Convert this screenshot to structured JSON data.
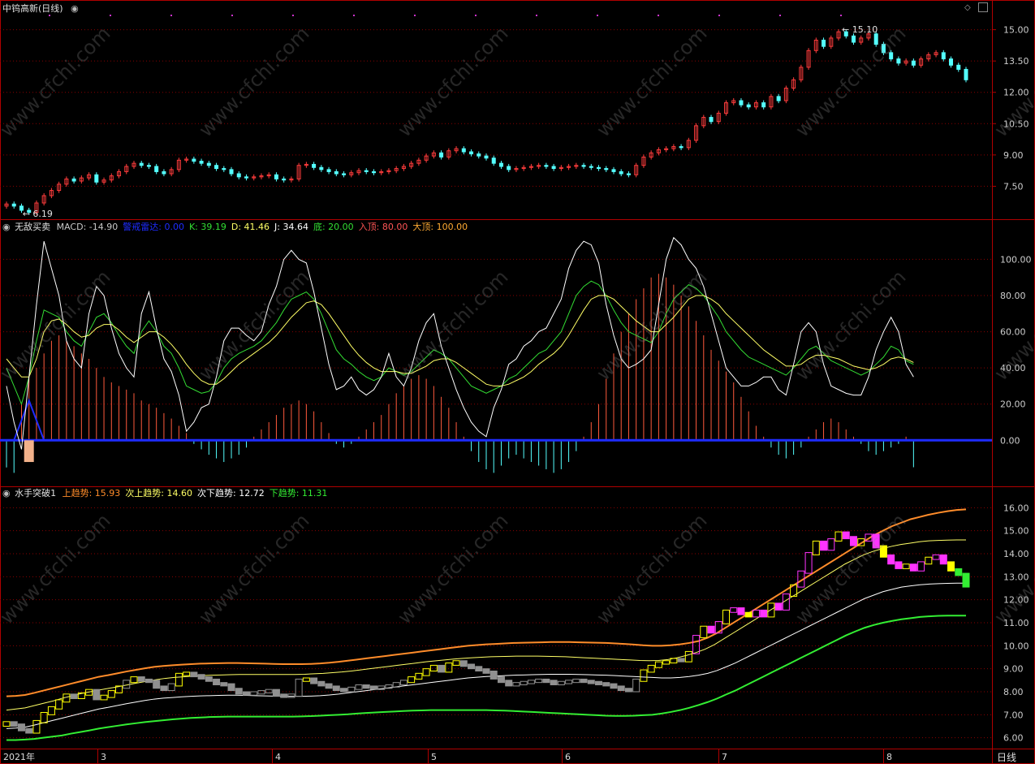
{
  "colors": {
    "background": "#000000",
    "frame": "#b00000",
    "up": "#ff3c3c",
    "down": "#54ffff",
    "white": "#ffffff",
    "yellow": "#ffff00",
    "magenta": "#ff33ff",
    "gray": "#909090",
    "orange": "#ff8c2a",
    "green": "#33ee33",
    "blue": "#1e2cff"
  },
  "panel1": {
    "title": "中钨高新(日线)",
    "marker_high": "15.10",
    "marker_low": "6.19",
    "axis_ticks": [
      "15.00",
      "13.50",
      "12.00",
      "10.50",
      "9.00",
      "7.50"
    ]
  },
  "panel2": {
    "name": "无敌买卖",
    "legend": [
      {
        "label": "MACD: -14.90",
        "color": "#c8c8c8"
      },
      {
        "label": "警戒雷达: 0.00",
        "color": "#1e2cff"
      },
      {
        "label": "K: 39.19",
        "color": "#33dd33"
      },
      {
        "label": "D: 41.46",
        "color": "#ffff66"
      },
      {
        "label": "J: 34.64",
        "color": "#ffffff"
      },
      {
        "label": "底: 20.00",
        "color": "#33dd33"
      },
      {
        "label": "入顶: 80.00",
        "color": "#ff5555"
      },
      {
        "label": "大顶: 100.00",
        "color": "#ffaa33"
      }
    ],
    "axis_ticks": [
      "100.00",
      "80.00",
      "60.00",
      "40.00",
      "20.00",
      "0.00"
    ]
  },
  "panel3": {
    "name": "水手突破1",
    "legend": [
      {
        "label": "上趋势: 15.93",
        "color": "#ff8c2a"
      },
      {
        "label": "次上趋势: 14.60",
        "color": "#ffff66"
      },
      {
        "label": "次下趋势: 12.72",
        "color": "#ffffff"
      },
      {
        "label": "下趋势: 11.31",
        "color": "#33ee33"
      }
    ],
    "axis_ticks": [
      "16.00",
      "15.00",
      "14.00",
      "13.00",
      "12.00",
      "11.00",
      "10.00",
      "9.00",
      "8.00",
      "7.00",
      "6.00"
    ]
  },
  "x_axis": {
    "labels": [
      "2021年",
      "3",
      "4",
      "5",
      "6",
      "7",
      "8"
    ],
    "period": "日线"
  },
  "watermark": "www.cfchi.com",
  "chart_data": [
    {
      "type": "candlestick",
      "title": "中钨高新(日线)",
      "ylim": [
        6.0,
        15.8
      ],
      "note_high": 15.1,
      "note_low": 6.19,
      "close": [
        6.65,
        6.55,
        6.35,
        6.25,
        6.7,
        7.05,
        7.3,
        7.6,
        7.85,
        7.75,
        7.9,
        8.05,
        7.7,
        7.8,
        8.0,
        8.2,
        8.45,
        8.6,
        8.5,
        8.45,
        8.2,
        8.1,
        8.3,
        8.75,
        8.8,
        8.7,
        8.6,
        8.5,
        8.35,
        8.3,
        8.1,
        7.95,
        7.9,
        7.95,
        8.0,
        8.05,
        7.85,
        7.8,
        7.85,
        8.5,
        8.55,
        8.4,
        8.3,
        8.2,
        8.1,
        8.05,
        8.15,
        8.25,
        8.2,
        8.15,
        8.2,
        8.25,
        8.35,
        8.45,
        8.6,
        8.75,
        8.95,
        9.1,
        8.9,
        9.2,
        9.3,
        9.15,
        9.05,
        8.95,
        8.85,
        8.6,
        8.45,
        8.3,
        8.35,
        8.4,
        8.45,
        8.5,
        8.45,
        8.35,
        8.4,
        8.45,
        8.5,
        8.45,
        8.4,
        8.35,
        8.3,
        8.2,
        8.1,
        8.05,
        8.5,
        8.9,
        9.1,
        9.25,
        9.3,
        9.4,
        9.35,
        9.7,
        10.4,
        10.8,
        10.6,
        11.0,
        11.5,
        11.6,
        11.4,
        11.3,
        11.5,
        11.3,
        11.8,
        11.6,
        12.2,
        12.6,
        13.2,
        14.0,
        14.5,
        14.2,
        14.6,
        14.9,
        14.7,
        14.4,
        14.6,
        14.8,
        14.3,
        13.9,
        13.6,
        13.4,
        13.5,
        13.3,
        13.6,
        13.8,
        13.9,
        13.6,
        13.3,
        13.1,
        12.6
      ],
      "volume_style": "none"
    },
    {
      "type": "line",
      "title": "无敌买卖",
      "ylim": [
        -25,
        115
      ],
      "series": [
        {
          "name": "K",
          "values": [
            40,
            30,
            20,
            35,
            55,
            72,
            70,
            68,
            60,
            55,
            52,
            60,
            68,
            70,
            65,
            58,
            52,
            48,
            60,
            66,
            60,
            52,
            48,
            40,
            30,
            28,
            26,
            27,
            32,
            40,
            45,
            48,
            50,
            52,
            55,
            60,
            65,
            72,
            78,
            80,
            82,
            78,
            70,
            60,
            50,
            45,
            42,
            38,
            35,
            33,
            35,
            40,
            38,
            36,
            38,
            42,
            46,
            50,
            48,
            45,
            40,
            35,
            30,
            28,
            26,
            28,
            30,
            34,
            36,
            40,
            44,
            48,
            50,
            55,
            60,
            70,
            80,
            85,
            88,
            86,
            80,
            72,
            65,
            60,
            58,
            56,
            54,
            60,
            70,
            78,
            82,
            86,
            84,
            80,
            74,
            68,
            60,
            55,
            50,
            46,
            44,
            42,
            40,
            38,
            36,
            40,
            45,
            50,
            52,
            48,
            44,
            42,
            40,
            38,
            36,
            38,
            42,
            46,
            52,
            50,
            44,
            42
          ],
          "color": "#33dd33"
        },
        {
          "name": "D",
          "values": [
            45,
            40,
            35,
            35,
            45,
            60,
            66,
            67,
            64,
            60,
            57,
            58,
            62,
            64,
            64,
            61,
            57,
            54,
            57,
            60,
            60,
            57,
            53,
            48,
            42,
            37,
            33,
            31,
            31,
            34,
            38,
            42,
            45,
            48,
            51,
            54,
            58,
            63,
            68,
            72,
            76,
            77,
            75,
            70,
            64,
            58,
            52,
            47,
            43,
            40,
            38,
            38,
            38,
            37,
            37,
            39,
            41,
            44,
            45,
            45,
            43,
            40,
            37,
            34,
            31,
            30,
            30,
            31,
            33,
            35,
            38,
            42,
            45,
            48,
            52,
            58,
            65,
            72,
            78,
            80,
            80,
            78,
            74,
            70,
            66,
            63,
            60,
            60,
            64,
            68,
            73,
            78,
            80,
            80,
            78,
            75,
            70,
            66,
            62,
            58,
            54,
            50,
            47,
            44,
            41,
            41,
            42,
            45,
            47,
            47,
            46,
            45,
            43,
            41,
            40,
            39,
            40,
            42,
            45,
            46,
            45,
            43
          ],
          "color": "#ffff66"
        },
        {
          "name": "J",
          "values": [
            30,
            10,
            -5,
            35,
            75,
            110,
            95,
            80,
            55,
            45,
            40,
            70,
            85,
            80,
            62,
            48,
            40,
            35,
            70,
            82,
            62,
            45,
            38,
            25,
            5,
            10,
            18,
            20,
            35,
            55,
            62,
            62,
            58,
            55,
            60,
            75,
            85,
            100,
            105,
            100,
            98,
            82,
            62,
            42,
            28,
            30,
            35,
            28,
            25,
            28,
            35,
            48,
            35,
            30,
            40,
            55,
            65,
            70,
            52,
            40,
            28,
            18,
            10,
            5,
            2,
            18,
            28,
            42,
            45,
            52,
            55,
            60,
            62,
            70,
            78,
            95,
            105,
            110,
            108,
            98,
            75,
            58,
            45,
            40,
            42,
            45,
            50,
            75,
            100,
            112,
            108,
            100,
            95,
            85,
            70,
            55,
            40,
            35,
            30,
            30,
            32,
            35,
            35,
            28,
            25,
            42,
            60,
            65,
            60,
            42,
            30,
            28,
            26,
            25,
            25,
            35,
            50,
            60,
            68,
            60,
            42,
            35
          ],
          "color": "#ffffff"
        }
      ],
      "bars_macd": [
        -15,
        -18,
        20,
        35,
        40,
        48,
        55,
        58,
        55,
        52,
        48,
        45,
        40,
        35,
        32,
        30,
        28,
        26,
        22,
        20,
        18,
        15,
        12,
        8,
        4,
        -2,
        -5,
        -8,
        -10,
        -12,
        -10,
        -8,
        -4,
        2,
        6,
        10,
        14,
        18,
        20,
        22,
        20,
        16,
        10,
        4,
        -2,
        -4,
        -2,
        2,
        6,
        10,
        14,
        20,
        26,
        30,
        34,
        36,
        34,
        30,
        24,
        18,
        10,
        2,
        -6,
        -12,
        -16,
        -18,
        -14,
        -10,
        -8,
        -10,
        -12,
        -14,
        -16,
        -18,
        -16,
        -12,
        -6,
        2,
        10,
        20,
        34,
        48,
        60,
        70,
        78,
        84,
        90,
        92,
        90,
        86,
        80,
        74,
        66,
        58,
        50,
        44,
        38,
        32,
        24,
        16,
        8,
        2,
        -4,
        -8,
        -10,
        -8,
        -4,
        2,
        6,
        10,
        12,
        10,
        6,
        2,
        -2,
        -6,
        -8,
        -6,
        -4,
        -2,
        2,
        -14.9
      ]
    },
    {
      "type": "line",
      "title": "水手突破1",
      "ylim": [
        5.6,
        16.4
      ],
      "series": [
        {
          "name": "上趋势",
          "color": "#ff8c2a",
          "values": [
            7.8,
            7.82,
            7.86,
            7.95,
            8.05,
            8.15,
            8.25,
            8.35,
            8.45,
            8.55,
            8.65,
            8.72,
            8.8,
            8.88,
            8.95,
            9.02,
            9.08,
            9.12,
            9.15,
            9.18,
            9.2,
            9.22,
            9.23,
            9.24,
            9.25,
            9.25,
            9.24,
            9.23,
            9.22,
            9.21,
            9.2,
            9.2,
            9.2,
            9.21,
            9.23,
            9.26,
            9.3,
            9.35,
            9.4,
            9.45,
            9.5,
            9.55,
            9.6,
            9.65,
            9.7,
            9.75,
            9.8,
            9.85,
            9.9,
            9.95,
            10.0,
            10.03,
            10.06,
            10.08,
            10.1,
            10.12,
            10.13,
            10.14,
            10.15,
            10.16,
            10.16,
            10.16,
            10.15,
            10.14,
            10.13,
            10.12,
            10.1,
            10.08,
            10.05,
            10.02,
            10.0,
            10.0,
            10.02,
            10.06,
            10.12,
            10.2,
            10.35,
            10.55,
            10.8,
            11.05,
            11.3,
            11.55,
            11.8,
            12.05,
            12.3,
            12.55,
            12.8,
            13.05,
            13.3,
            13.55,
            13.8,
            14.05,
            14.3,
            14.55,
            14.8,
            15.0,
            15.2,
            15.35,
            15.5,
            15.6,
            15.7,
            15.78,
            15.85,
            15.9,
            15.93
          ]
        },
        {
          "name": "次上趋势",
          "color": "#ffff66",
          "values": [
            7.2,
            7.25,
            7.3,
            7.4,
            7.5,
            7.6,
            7.72,
            7.82,
            7.92,
            8.0,
            8.08,
            8.15,
            8.22,
            8.3,
            8.38,
            8.45,
            8.52,
            8.58,
            8.62,
            8.65,
            8.68,
            8.7,
            8.72,
            8.73,
            8.74,
            8.75,
            8.75,
            8.75,
            8.75,
            8.75,
            8.75,
            8.75,
            8.76,
            8.78,
            8.8,
            8.83,
            8.86,
            8.9,
            8.95,
            9.0,
            9.05,
            9.1,
            9.15,
            9.2,
            9.25,
            9.3,
            9.34,
            9.38,
            9.42,
            9.45,
            9.48,
            9.5,
            9.52,
            9.53,
            9.54,
            9.55,
            9.55,
            9.55,
            9.54,
            9.53,
            9.52,
            9.5,
            9.48,
            9.46,
            9.44,
            9.42,
            9.4,
            9.38,
            9.36,
            9.35,
            9.36,
            9.4,
            9.48,
            9.58,
            9.7,
            9.85,
            10.05,
            10.3,
            10.55,
            10.8,
            11.05,
            11.3,
            11.55,
            11.8,
            12.05,
            12.3,
            12.55,
            12.8,
            13.05,
            13.3,
            13.55,
            13.75,
            13.95,
            14.1,
            14.22,
            14.32,
            14.4,
            14.46,
            14.52,
            14.56,
            14.58,
            14.59,
            14.6,
            14.6
          ]
        },
        {
          "name": "次下趋势",
          "color": "#ffffff",
          "values": [
            6.4,
            6.42,
            6.46,
            6.55,
            6.65,
            6.75,
            6.85,
            6.95,
            7.05,
            7.15,
            7.25,
            7.32,
            7.4,
            7.48,
            7.55,
            7.62,
            7.68,
            7.72,
            7.75,
            7.78,
            7.8,
            7.82,
            7.83,
            7.84,
            7.85,
            7.85,
            7.84,
            7.83,
            7.82,
            7.81,
            7.8,
            7.8,
            7.8,
            7.81,
            7.83,
            7.86,
            7.9,
            7.95,
            8.0,
            8.05,
            8.1,
            8.15,
            8.2,
            8.25,
            8.3,
            8.35,
            8.4,
            8.45,
            8.5,
            8.55,
            8.6,
            8.63,
            8.66,
            8.68,
            8.7,
            8.72,
            8.73,
            8.74,
            8.75,
            8.76,
            8.76,
            8.76,
            8.75,
            8.74,
            8.73,
            8.72,
            8.7,
            8.68,
            8.66,
            8.64,
            8.62,
            8.6,
            8.6,
            8.62,
            8.66,
            8.72,
            8.8,
            8.92,
            9.08,
            9.25,
            9.45,
            9.65,
            9.85,
            10.05,
            10.25,
            10.45,
            10.65,
            10.85,
            11.05,
            11.25,
            11.45,
            11.65,
            11.85,
            12.05,
            12.2,
            12.35,
            12.45,
            12.55,
            12.6,
            12.65,
            12.68,
            12.7,
            12.71,
            12.72,
            12.72
          ]
        },
        {
          "name": "下趋势",
          "color": "#33ee33",
          "values": [
            5.9,
            5.9,
            5.92,
            5.95,
            6.0,
            6.05,
            6.1,
            6.18,
            6.25,
            6.32,
            6.4,
            6.46,
            6.52,
            6.58,
            6.63,
            6.68,
            6.72,
            6.76,
            6.8,
            6.83,
            6.86,
            6.88,
            6.9,
            6.91,
            6.92,
            6.92,
            6.92,
            6.92,
            6.92,
            6.92,
            6.92,
            6.92,
            6.93,
            6.94,
            6.96,
            6.98,
            7.0,
            7.02,
            7.05,
            7.08,
            7.1,
            7.12,
            7.14,
            7.16,
            7.18,
            7.19,
            7.2,
            7.2,
            7.2,
            7.2,
            7.2,
            7.2,
            7.2,
            7.19,
            7.18,
            7.16,
            7.14,
            7.12,
            7.1,
            7.08,
            7.06,
            7.04,
            7.02,
            7.0,
            6.98,
            6.96,
            6.95,
            6.95,
            6.96,
            6.98,
            7.0,
            7.05,
            7.12,
            7.2,
            7.3,
            7.42,
            7.55,
            7.7,
            7.88,
            8.05,
            8.25,
            8.45,
            8.65,
            8.85,
            9.05,
            9.25,
            9.45,
            9.65,
            9.85,
            10.05,
            10.25,
            10.45,
            10.62,
            10.78,
            10.9,
            11.0,
            11.08,
            11.15,
            11.2,
            11.25,
            11.28,
            11.3,
            11.31,
            11.31,
            11.31
          ]
        }
      ]
    }
  ]
}
